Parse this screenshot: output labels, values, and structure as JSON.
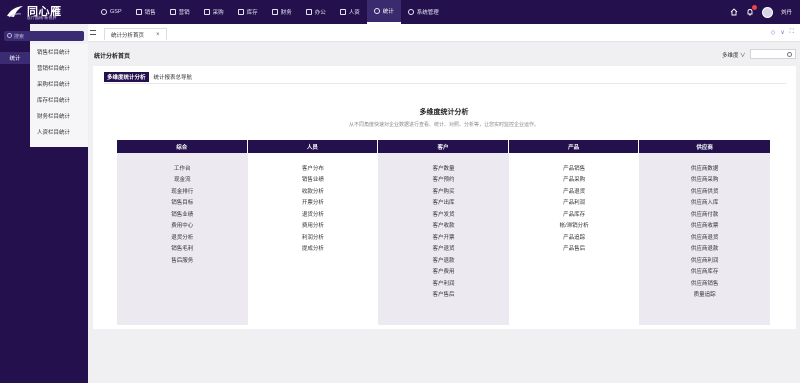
{
  "app": {
    "logo_title": "同心雁",
    "logo_subtitle": "医疗器械·新视界"
  },
  "nav": [
    {
      "label": "GSP",
      "icon": "gsp-icon"
    },
    {
      "label": "销售",
      "icon": "chart-bars-icon"
    },
    {
      "label": "营销",
      "icon": "chart-bars-icon"
    },
    {
      "label": "采购",
      "icon": "truck-icon"
    },
    {
      "label": "库存",
      "icon": "box-icon"
    },
    {
      "label": "财务",
      "icon": "coin-icon"
    },
    {
      "label": "办公",
      "icon": "briefcase-icon"
    },
    {
      "label": "人资",
      "icon": "person-icon"
    },
    {
      "label": "统计",
      "icon": "clock-icon"
    },
    {
      "label": "系统管理",
      "icon": "gear-icon"
    }
  ],
  "nav_active_index": 8,
  "user": {
    "name": "刘丹"
  },
  "sidebar": {
    "search_placeholder": "搜索",
    "primary_item": "统计",
    "items": [
      "销售栏目统计",
      "营销栏目统计",
      "采购栏目统计",
      "库存栏目统计",
      "财务栏目统计",
      "人资栏目统计"
    ]
  },
  "tabs": [
    {
      "label": "统计分析首页",
      "close": "×"
    }
  ],
  "tab_actions": [
    "◇",
    "∨",
    "⛶"
  ],
  "page": {
    "title": "统计分析首页",
    "dimension_select": "多维度 ∨",
    "subtabs": [
      "多维度统计分析",
      "统计报表总导航"
    ],
    "active_subtab": 0,
    "section_title": "多维度统计分析",
    "section_desc": "从不同角度快速对企业数据进行查看、统计、对照、分析等，让您实时监控企业运作。"
  },
  "matrix": [
    {
      "header": "综合",
      "shade": true,
      "items": [
        "工作台",
        "现金流",
        "现金排行",
        "销售目标",
        "销售业绩",
        "费用中心",
        "退货分析",
        "销售毛利",
        "售后服务"
      ]
    },
    {
      "header": "人员",
      "shade": false,
      "items": [
        "客户分布",
        "销售业绩",
        "收款分析",
        "开票分析",
        "退货分析",
        "费用分析",
        "利润分析",
        "提成分析"
      ]
    },
    {
      "header": "客户",
      "shade": true,
      "items": [
        "客户数量",
        "客户预约",
        "客户购买",
        "客户出库",
        "客户发货",
        "客户收款",
        "客户开票",
        "客户退货",
        "客户退款",
        "客户费用",
        "客户利润",
        "客户售后"
      ]
    },
    {
      "header": "产品",
      "shade": false,
      "items": [
        "产品销售",
        "产品采购",
        "产品退货",
        "产品利润",
        "产品库存",
        "帐/滞销分析",
        "产品追踪",
        "产品售后"
      ]
    },
    {
      "header": "供应商",
      "shade": true,
      "items": [
        "供应商数据",
        "供应商采购",
        "供应商供货",
        "供应商入库",
        "供应商付款",
        "供应商收票",
        "供应商退货",
        "供应商退款",
        "供应商利润",
        "供应商库存",
        "供应商销售",
        "质量追踪"
      ]
    }
  ]
}
